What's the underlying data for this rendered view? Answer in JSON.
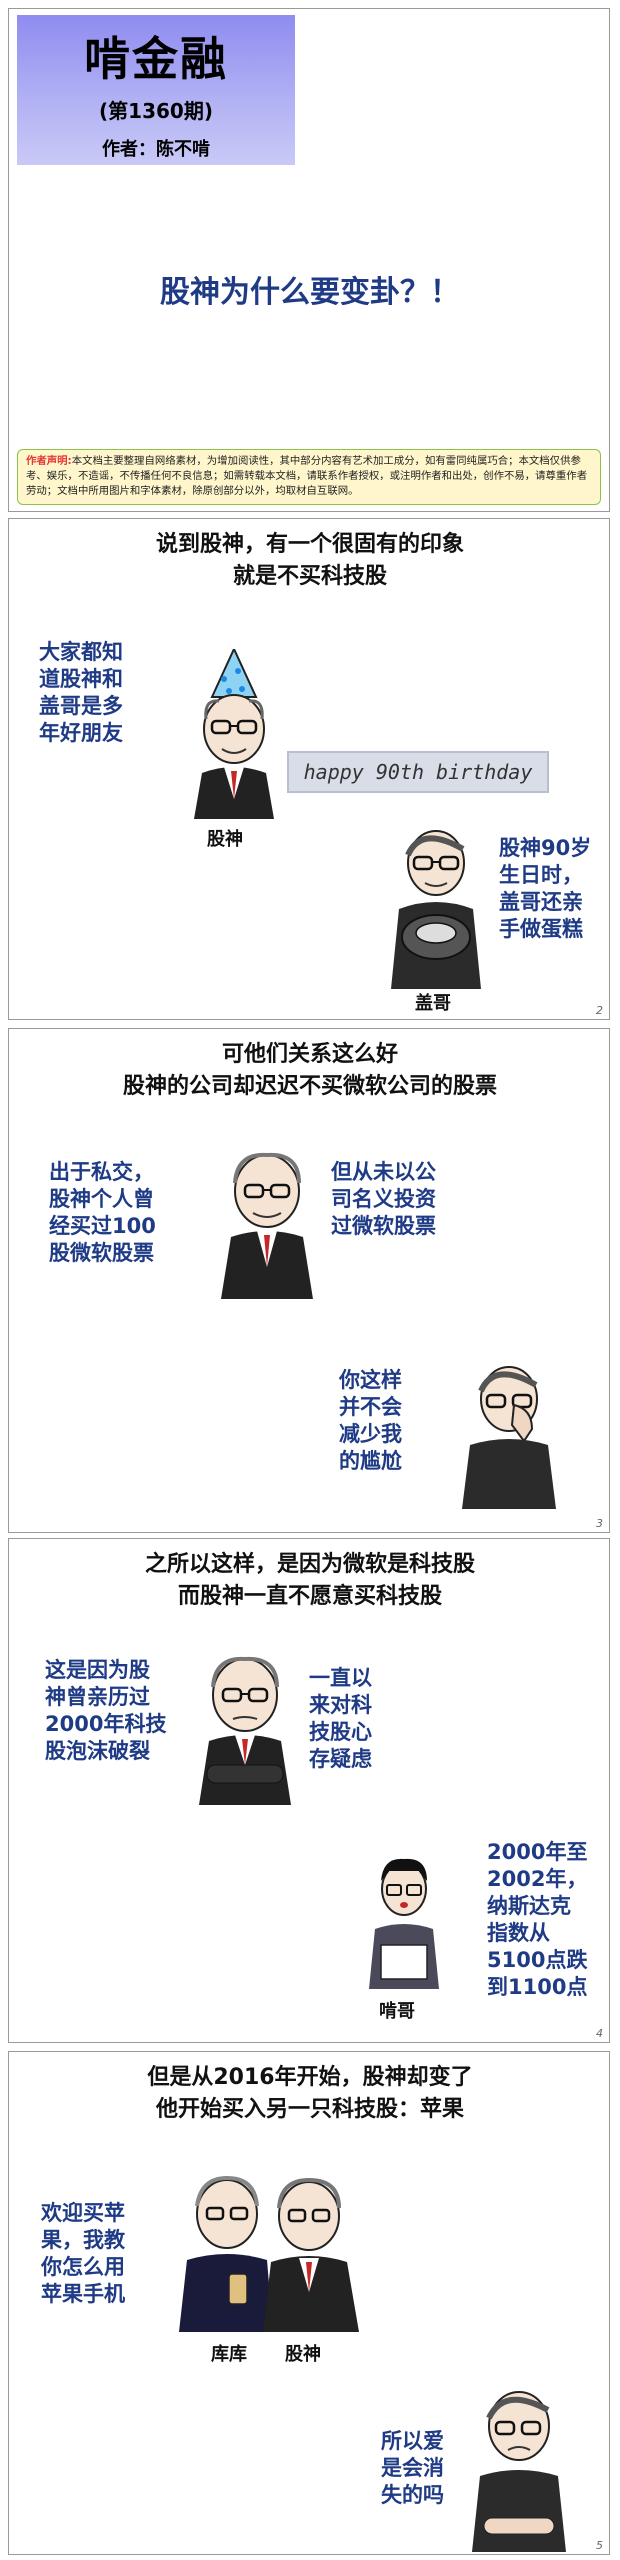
{
  "cover": {
    "brand": "啃金融",
    "issue": "(第1360期)",
    "author": "作者：陈不啃",
    "title": "股神为什么要变卦？！",
    "notice_label": "作者声明:",
    "notice_text": "本文档主要整理自网络素材，为增加阅读性，其中部分内容有艺术加工成分，如有雷同纯属巧合；本文档仅供参考、娱乐，不造谣，不传播任何不良信息；如需转载本文档，请联系作者授权，或注明作者和出处，创作不易，请尊重作者劳动；文档中所用图片和字体素材，除原创部分以外，均取材自互联网。"
  },
  "panel2": {
    "heading_line1": "说到股神，有一个很固有的印象",
    "heading_line2": "就是不买科技股",
    "left_text": [
      "大家都知",
      "道股神和",
      "盖哥是多",
      "年好朋友"
    ],
    "banner": "happy 90th birthday",
    "buffett_label": "股神",
    "right_text": [
      "股神90岁",
      "生日时，",
      "盖哥还亲",
      "手做蛋糕"
    ],
    "gates_label": "盖哥",
    "page": "2"
  },
  "panel3": {
    "heading_line1": "可他们关系这么好",
    "heading_line2": "股神的公司却迟迟不买微软公司的股票",
    "left_text": [
      "出于私交，",
      "股神个人曾",
      "经买过100",
      "股微软股票"
    ],
    "right_text": [
      "但从未以公",
      "司名义投资",
      "过微软股票"
    ],
    "gates_text": [
      "你这样",
      "并不会",
      "减少我",
      "的尴尬"
    ],
    "page": "3"
  },
  "panel4": {
    "heading_line1": "之所以这样，是因为微软是科技股",
    "heading_line2": "而股神一直不愿意买科技股",
    "left_text": [
      "这是因为股",
      "神曾亲历过",
      "2000年科技",
      "股泡沫破裂"
    ],
    "mid_text": [
      "一直以",
      "来对科",
      "技股心",
      "存疑虑"
    ],
    "right_text": [
      "2000年至",
      "2002年，",
      "纳斯达克",
      "指数从",
      "5100点跌",
      "到1100点"
    ],
    "narrator_label": "啃哥",
    "page": "4"
  },
  "panel5": {
    "heading_line1": "但是从2016年开始，股神却变了",
    "heading_line2": "他开始买入另一只科技股：苹果",
    "left_text": [
      "欢迎买苹",
      "果，我教",
      "你怎么用",
      "苹果手机"
    ],
    "cook_label": "库库",
    "buffett_label": "股神",
    "gates_text": [
      "所以爱",
      "是会消",
      "失的吗"
    ],
    "page": "5"
  },
  "colors": {
    "accent_blue": "#1f3b86",
    "title_gradient": "#9b98f2",
    "notice_bg": "#fff6cc",
    "notice_border": "#8bc34a",
    "tie_red": "#c62828"
  }
}
